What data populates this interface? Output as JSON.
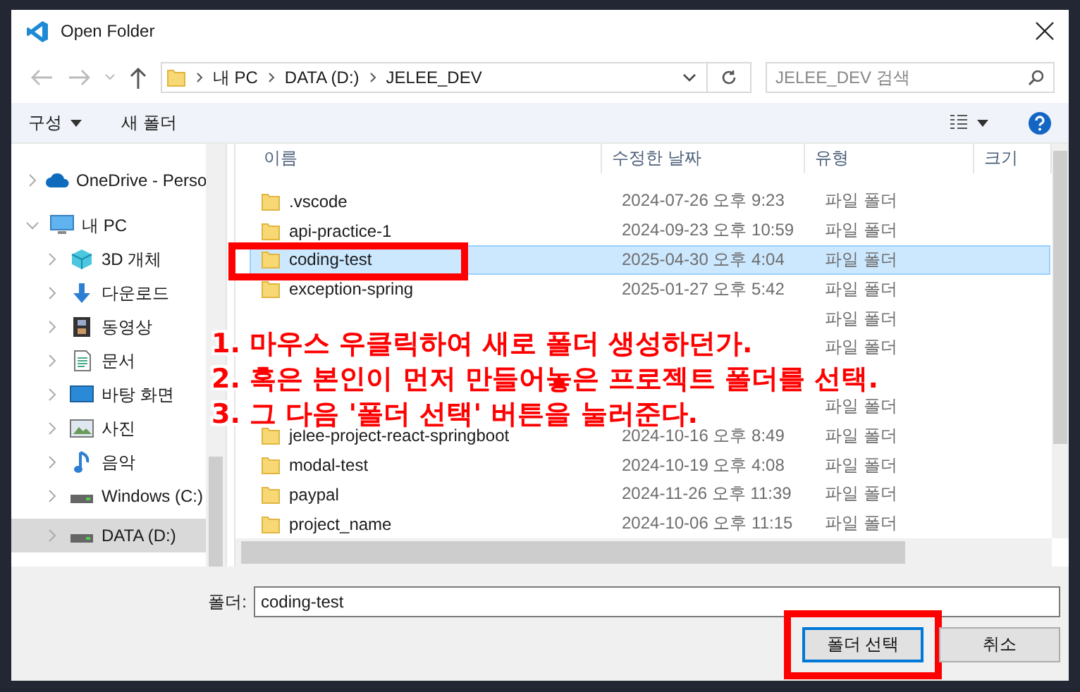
{
  "window": {
    "title": "Open Folder"
  },
  "address": {
    "path": [
      "내 PC",
      "DATA (D:)",
      "JELEE_DEV"
    ]
  },
  "search": {
    "placeholder": "JELEE_DEV 검색"
  },
  "toolbar": {
    "organize": "구성",
    "new_folder": "새 폴더"
  },
  "sidebar": {
    "items": [
      {
        "label": "OneDrive - Perso",
        "kind": "cloud",
        "expanded": false,
        "selected": false
      },
      {
        "label": "내 PC",
        "kind": "pc",
        "expanded": true,
        "selected": false,
        "children": [
          {
            "label": "3D 개체",
            "kind": "cube",
            "selected": false
          },
          {
            "label": "다운로드",
            "kind": "download",
            "selected": false
          },
          {
            "label": "동영상",
            "kind": "video",
            "selected": false
          },
          {
            "label": "문서",
            "kind": "document",
            "selected": false
          },
          {
            "label": "바탕 화면",
            "kind": "desktop",
            "selected": false
          },
          {
            "label": "사진",
            "kind": "picture",
            "selected": false
          },
          {
            "label": "음악",
            "kind": "music",
            "selected": false
          },
          {
            "label": "Windows (C:)",
            "kind": "drive",
            "selected": false
          },
          {
            "label": "DATA (D:)",
            "kind": "drive",
            "selected": true
          }
        ]
      }
    ]
  },
  "file_list": {
    "columns": [
      "이름",
      "수정한 날짜",
      "유형",
      "크기"
    ],
    "rows": [
      {
        "name": ".vscode",
        "modified": "2024-07-26 오후 9:23",
        "type": "파일 폴더",
        "selected": false,
        "annotated": false
      },
      {
        "name": "api-practice-1",
        "modified": "2024-09-23 오후 10:59",
        "type": "파일 폴더",
        "selected": false,
        "annotated": false
      },
      {
        "name": "coding-test",
        "modified": "2025-04-30 오후 4:04",
        "type": "파일 폴더",
        "selected": true,
        "annotated": true
      },
      {
        "name": "exception-spring",
        "modified": "2025-01-27 오후 5:42",
        "type": "파일 폴더",
        "selected": false,
        "annotated": false
      },
      {
        "type": "파일 폴더",
        "selected": false,
        "annotated": false
      },
      {
        "type": "파일 폴더",
        "selected": false,
        "annotated": false
      },
      {
        "selected": false,
        "annotated": false
      },
      {
        "type": "파일 폴더",
        "selected": false,
        "annotated": false
      },
      {
        "name": "jelee-project-react-springboot",
        "modified": "2024-10-16 오후 8:49",
        "type": "파일 폴더",
        "selected": false,
        "annotated": false
      },
      {
        "name": "modal-test",
        "modified": "2024-10-19 오후 4:08",
        "type": "파일 폴더",
        "selected": false,
        "annotated": false
      },
      {
        "name": "paypal",
        "modified": "2024-11-26 오후 11:39",
        "type": "파일 폴더",
        "selected": false,
        "annotated": false
      },
      {
        "name": "project_name",
        "modified": "2024-10-06 오후 11:15",
        "type": "파일 폴더",
        "selected": false,
        "annotated": false
      }
    ]
  },
  "footer": {
    "folder_label": "폴더:",
    "folder_value": "coding-test",
    "buttons": [
      {
        "label": "폴더 선택",
        "default": true,
        "annotated": true
      },
      {
        "label": "취소",
        "default": false,
        "annotated": false
      }
    ]
  },
  "annotation": {
    "steps": [
      "1. 마우스 우클릭하여 새로 폴더 생성하던가.",
      "2. 혹은 본인이 먼저 만들어놓은 프로젝트 폴더를 선택.",
      "3. 그 다음 '폴더 선택' 버튼을 눌러준다."
    ]
  }
}
